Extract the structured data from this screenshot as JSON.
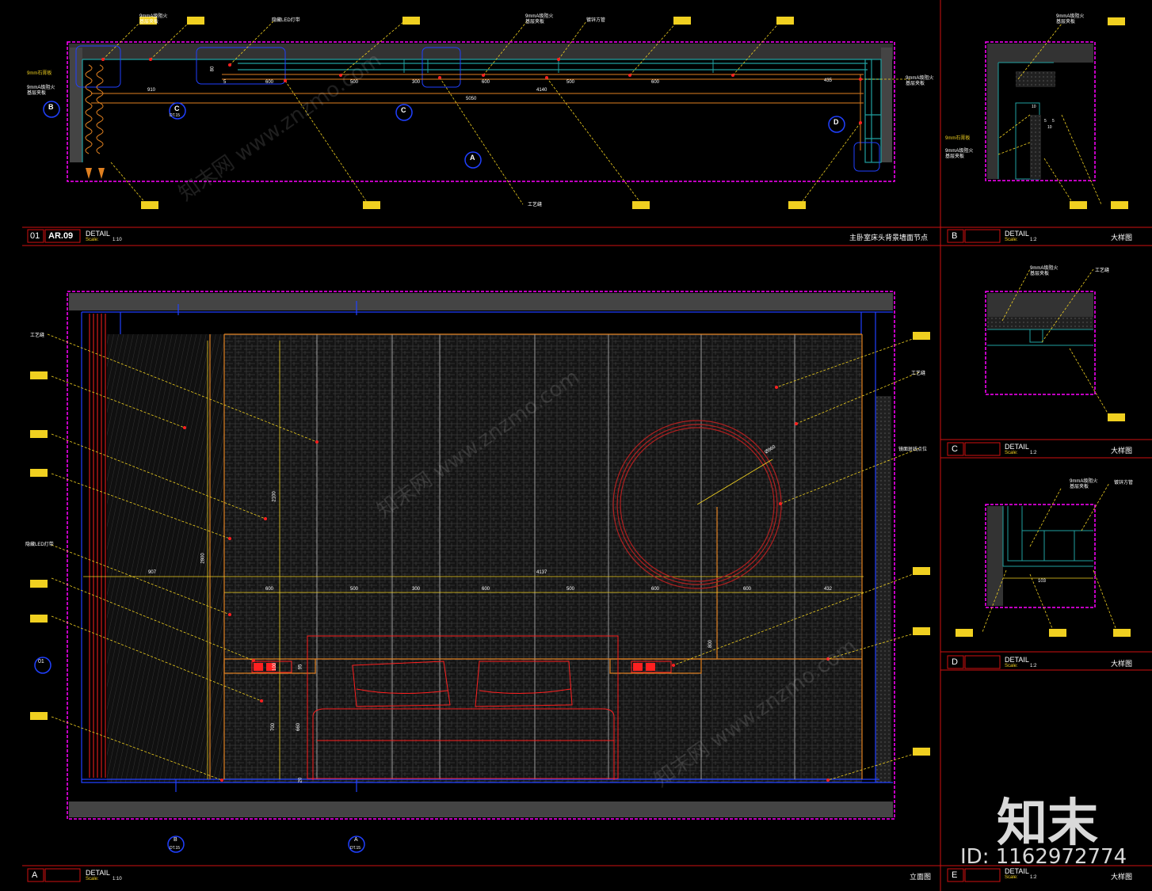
{
  "colors": {
    "background": "#000000",
    "frame_magenta": "#ff00ff",
    "title_line_red": "#d01010",
    "dim_yellow": "#f0d020",
    "wall_blue": "#2040ff",
    "panel_orange": "#e08020",
    "teal": "#20a0a0",
    "red_detail": "#ff2020"
  },
  "panels": {
    "p01": {
      "number": "01",
      "ref": "AR.09",
      "detail_label": "DETAIL",
      "scale_label": "Scale:",
      "scale_value": "1:10",
      "title": "主卧室床头背景墙面节点"
    },
    "pA": {
      "number": "A",
      "detail_label": "DETAIL",
      "scale_label": "Scale:",
      "scale_value": "1:10",
      "title": "立面图"
    },
    "pB": {
      "number": "B",
      "detail_label": "DETAIL",
      "scale_label": "Scale:",
      "scale_value": "1:2",
      "title": "大样图"
    },
    "pC": {
      "number": "C",
      "detail_label": "DETAIL",
      "scale_label": "Scale:",
      "scale_value": "1:2",
      "title": "大样图"
    },
    "pD": {
      "number": "D",
      "detail_label": "DETAIL",
      "scale_label": "Scale:",
      "scale_value": "1:2",
      "title": "大样图"
    },
    "pE": {
      "number": "E",
      "detail_label": "DETAIL",
      "scale_label": "Scale:",
      "scale_value": "1:2",
      "title": "大样图"
    }
  },
  "plan_labels": {
    "top_1": "9mmA级阻火\n基层夹板",
    "top_2": "隐藏LED灯带",
    "top_3": "9mmA级阻火\n基层夹板",
    "top_4": "镀锌方管",
    "left_1": "9mm石膏板",
    "left_2": "9mmA级阻火\n基层夹板",
    "right_1": "9mmA级阻火\n基层夹板",
    "bottom_gap": "工艺缝"
  },
  "plan_dims": {
    "d80": "80",
    "row1": [
      "600",
      "500",
      "300",
      "600",
      "500",
      "600",
      "435"
    ],
    "d5": "5",
    "d910": "910",
    "d4140": "4140",
    "d5050": "5050"
  },
  "elev_labels": {
    "gap_left": "工艺缝",
    "gap_right": "工艺缝",
    "led": "隐藏LED灯带",
    "mirror_edge": "镜面斑线点位"
  },
  "elev_dims": {
    "d907": "907",
    "d4137": "4137",
    "row1": [
      "600",
      "500",
      "300",
      "600",
      "500",
      "600",
      "600",
      "432"
    ],
    "d2100": "2100",
    "d2800": "2800",
    "d800": "800",
    "d700": "700",
    "d660": "660",
    "d20": "20",
    "d100": "100",
    "d95": "95",
    "circle_dia": "Ø960"
  },
  "markers": {
    "sec_B": "B",
    "sec_C1": "C",
    "sec_C2": "C",
    "sec_D": "D",
    "sec_A": "A",
    "elev_01": "01",
    "bottom_B": "B",
    "bottom_A": "A",
    "sheet_ref_c": "DT.15",
    "sheet_ref_b": "DT.15",
    "sheet_ref_a": "DT.15"
  },
  "detail_labels": {
    "b_1": "9mmA级阻火\n基层夹板",
    "b_2": "9mm石膏板",
    "b_3": "9mmA级阻火\n基层夹板",
    "b_dim1": "10",
    "b_dim2": "5",
    "b_dim3": "5",
    "b_dim4": "10",
    "c_1": "9mmA级阻火\n基层夹板",
    "c_2": "工艺缝",
    "d_1": "9mmA级阻火\n基层夹板",
    "d_2": "镀锌方管",
    "d_dim": "103"
  },
  "watermark": {
    "logo": "知末",
    "id": "ID: 1162972774",
    "diag": "知末网 www.znzmo.com"
  }
}
